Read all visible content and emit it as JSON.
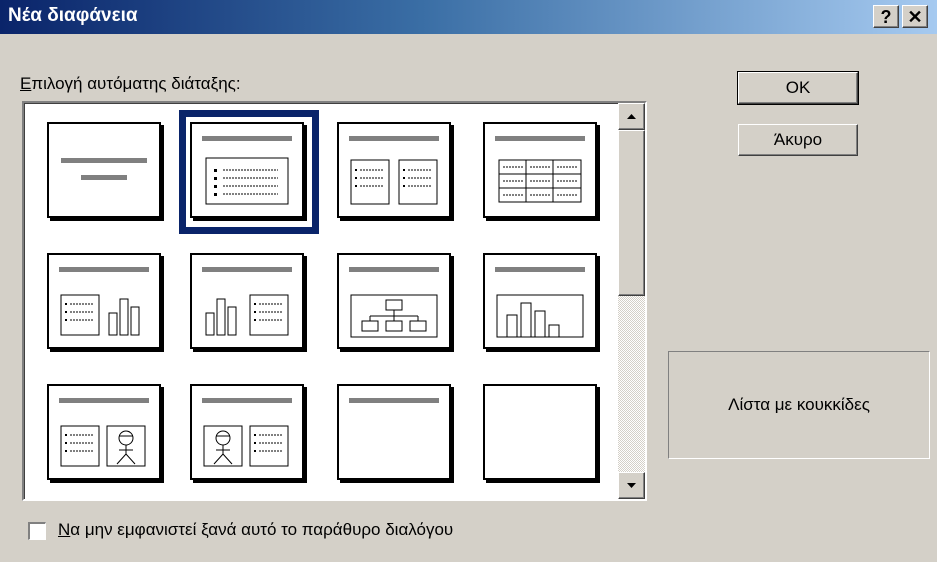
{
  "window": {
    "title": "Νέα διαφάνεια",
    "help_glyph": "?",
    "close_glyph": "✕"
  },
  "layout_label_accel": "Ε",
  "layout_label_rest": "πιλογή αυτόματης διάταξης:",
  "buttons": {
    "ok": "OK",
    "cancel": "Άκυρο"
  },
  "preview_text": "Λίστα με κουκκίδες",
  "checkbox": {
    "accel": "Ν",
    "rest": "α μην εμφανιστεί ξανά αυτό το παράθυρο διαλόγου",
    "checked": false
  },
  "layouts": [
    {
      "icon": "title-layout-icon",
      "selected": false
    },
    {
      "icon": "bulleted-list-layout-icon",
      "selected": true
    },
    {
      "icon": "two-column-text-layout-icon",
      "selected": false
    },
    {
      "icon": "table-layout-icon",
      "selected": false
    },
    {
      "icon": "text-and-chart-layout-icon",
      "selected": false
    },
    {
      "icon": "chart-and-text-layout-icon",
      "selected": false
    },
    {
      "icon": "organization-chart-layout-icon",
      "selected": false
    },
    {
      "icon": "chart-layout-icon",
      "selected": false
    },
    {
      "icon": "text-and-clip-art-layout-icon",
      "selected": false
    },
    {
      "icon": "clip-art-and-text-layout-icon",
      "selected": false
    },
    {
      "icon": "title-only-layout-icon",
      "selected": false
    },
    {
      "icon": "blank-layout-icon",
      "selected": false
    }
  ]
}
